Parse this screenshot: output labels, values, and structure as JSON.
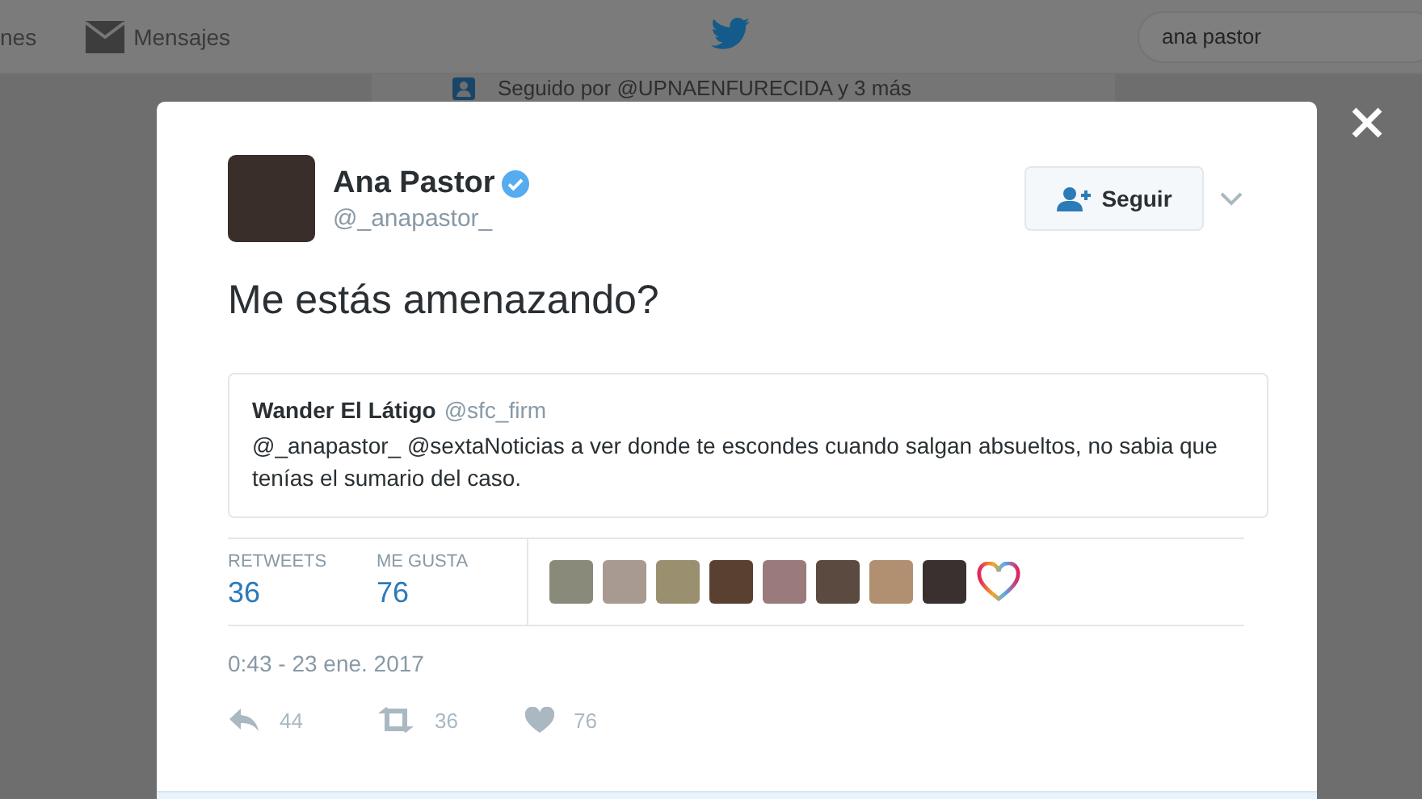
{
  "nav": {
    "items": [
      {
        "label": "nes"
      },
      {
        "label": "Mensajes"
      }
    ],
    "search": {
      "value": "ana pastor"
    }
  },
  "background": {
    "followed_by": "Seguido por @UPNAENFURECIDA y 3 más"
  },
  "tweet": {
    "name": "Ana Pastor",
    "verified": true,
    "handle": "@_anapastor_",
    "follow_button": "Seguir",
    "text": "Me estás amenazando?",
    "quote": {
      "name": "Wander El Látigo",
      "handle": "@sfc_firm",
      "text": "@_anapastor_ @sextaNoticias a ver donde te escondes cuando salgan absueltos, no sabia que tenías el sumario del caso."
    },
    "stats": [
      {
        "label": "RETWEETS",
        "value": "36"
      },
      {
        "label": "ME GUSTA",
        "value": "76"
      }
    ],
    "timestamp": "0:43 - 23 ene. 2017",
    "actions": [
      {
        "kind": "reply",
        "count": "44"
      },
      {
        "kind": "retweet",
        "count": "36"
      },
      {
        "kind": "like",
        "count": "76"
      }
    ]
  }
}
